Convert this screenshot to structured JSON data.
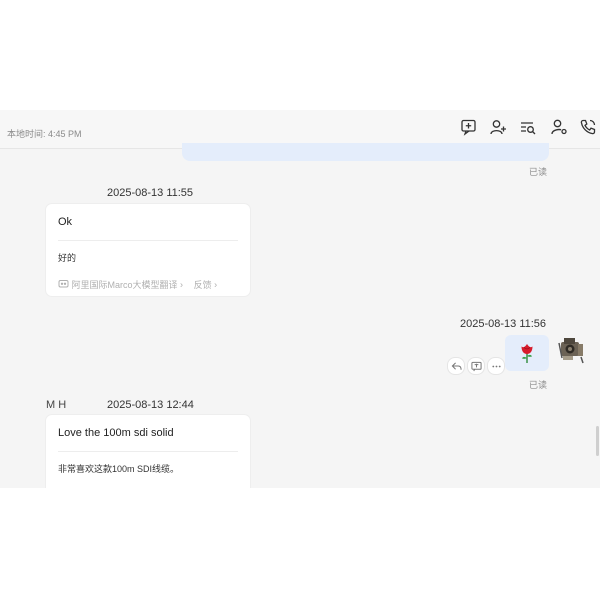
{
  "header": {
    "local_time": "本地时间: 4:45 PM",
    "icons": [
      "add-note-icon",
      "add-contact-icon",
      "search-list-icon",
      "user-settings-icon",
      "phone-icon"
    ]
  },
  "messages": [
    {
      "read_label": "已读"
    },
    {
      "sender": "",
      "timestamp": "2025-08-13 11:55",
      "original": "Ok",
      "translation": "好的",
      "translator": "阿里国际Marco大模型翻译",
      "feedback": "反馈"
    },
    {
      "timestamp": "2025-08-13 11:56",
      "content_icon": "rose-icon",
      "read_label": "已读",
      "actions": [
        "reply-icon",
        "translate-icon",
        "more-icon"
      ]
    },
    {
      "sender": "M     H",
      "timestamp": "2025-08-13 12:44",
      "original": "Love the 100m sdi solid",
      "translation": "非常喜欢这款100m SDI线缆。"
    }
  ]
}
